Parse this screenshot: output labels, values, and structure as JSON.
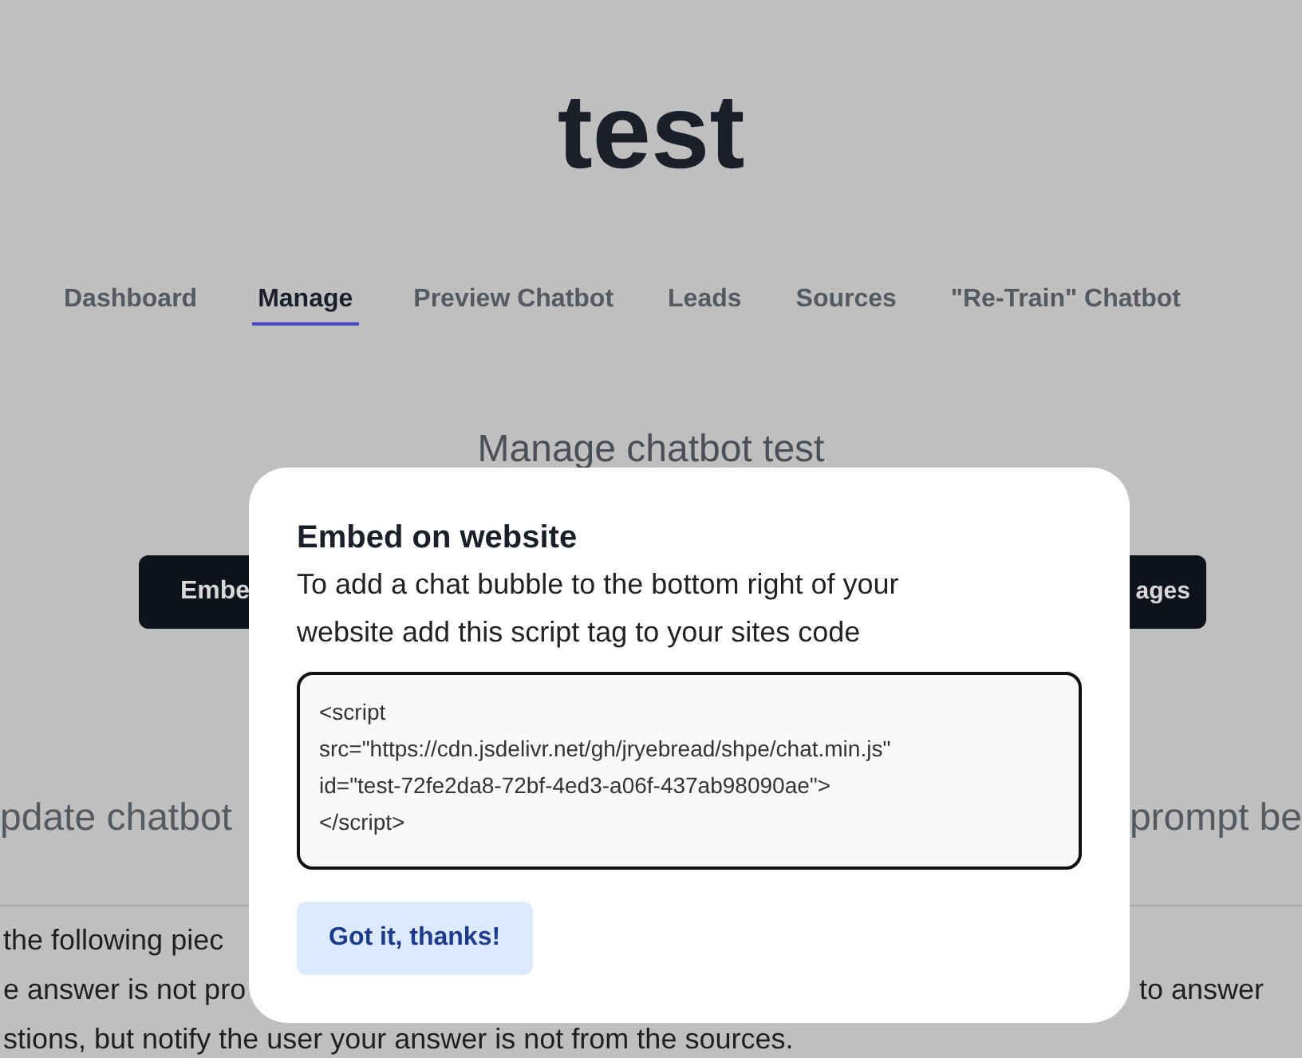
{
  "site_title": "test",
  "nav": [
    {
      "label": "Dashboard",
      "selected": false
    },
    {
      "label": "Manage",
      "selected": true
    },
    {
      "label": "Preview Chatbot",
      "selected": false
    },
    {
      "label": "Leads",
      "selected": false
    },
    {
      "label": "Sources",
      "selected": false
    },
    {
      "label": "\"Re-Train\" Chatbot",
      "selected": false
    }
  ],
  "heading": "Manage chatbot test",
  "action_buttons": {
    "left": "Embe",
    "right": "ages"
  },
  "section_headings": {
    "left": "pdate chatbot",
    "right": "prompt be"
  },
  "prompt_lines": [
    {
      "left": "the following piec"
    },
    {
      "left": "e answer is not pro",
      "right": "to answer"
    },
    {
      "left": "stions, but notify the user your answer is not from the sources."
    }
  ],
  "modal": {
    "title": "Embed on website",
    "description": "To add a chat bubble to the bottom right of your website add this script tag to your sites code",
    "code": "<script\nsrc=\"https://cdn.jsdelivr.net/gh/jryebread/shpe/chat.min.js\"\nid=\"test-72fe2da8-72bf-4ed3-a06f-437ab98090ae\">\n</script>",
    "button": "Got it, thanks!"
  }
}
